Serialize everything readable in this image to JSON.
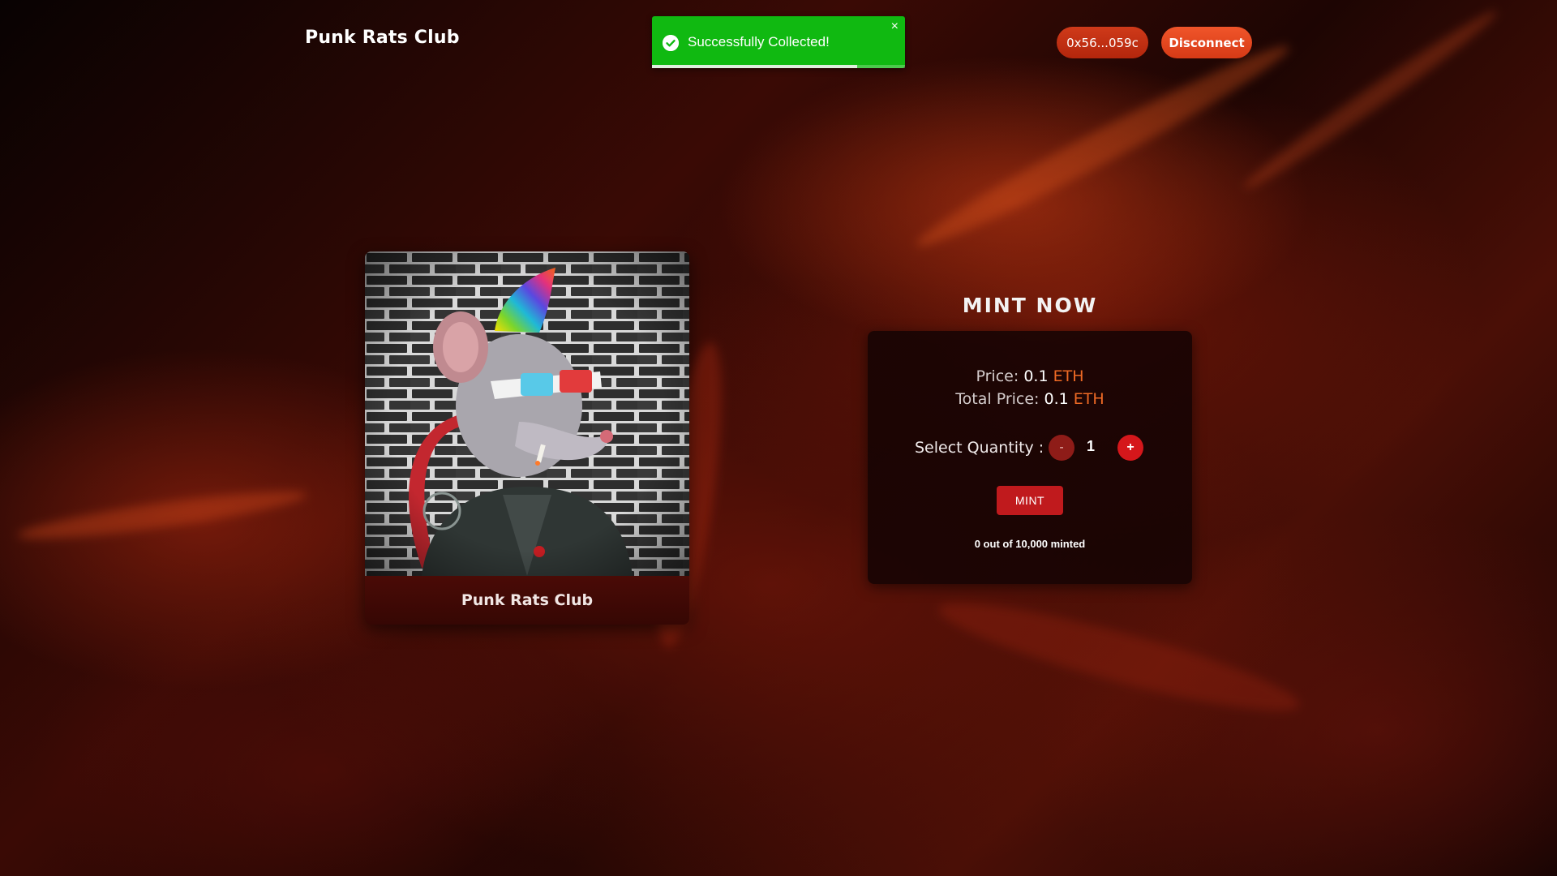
{
  "header": {
    "brand": "Punk Rats Club",
    "wallet_address": "0x56...059c",
    "disconnect_label": "Disconnect"
  },
  "toast": {
    "message": "Successfully Collected!",
    "close_symbol": "×",
    "progress_fraction": 0.81,
    "status_color": "#10b911"
  },
  "nft": {
    "name": "Punk Rats Club"
  },
  "mint": {
    "title": "MINT NOW",
    "price_label": "Price:",
    "price_value": "0.1",
    "price_unit": "ETH",
    "total_label": "Total Price:",
    "total_value": "0.1",
    "total_unit": "ETH",
    "quantity_label": "Select Quantity :",
    "minus_label": "-",
    "plus_label": "+",
    "quantity": "1",
    "mint_label": "MINT",
    "minted_status": "0 out of 10,000 minted"
  },
  "colors": {
    "accent": "#d5171b",
    "eth_unit": "#ef6a25",
    "button_orange": "#f0552a"
  },
  "icons": {
    "toast_status": "check-circle-icon",
    "toast_close": "close-icon"
  }
}
